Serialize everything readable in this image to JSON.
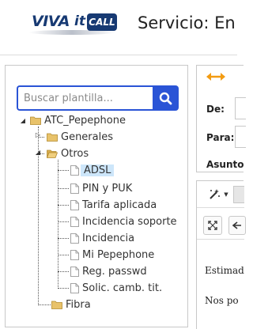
{
  "header": {
    "logo": {
      "brand": "VIVA",
      "brand_suffix": "it",
      "badge": "CALL"
    },
    "title": "Servicio: En"
  },
  "search": {
    "placeholder": "Buscar plantilla..."
  },
  "tree": {
    "root": "ATC_Pepephone",
    "folders": {
      "generales": "Generales",
      "otros": "Otros",
      "fibra": "Fibra"
    },
    "otros_items": [
      "ADSL",
      "PIN y PUK",
      "Tarifa aplicada",
      "Incidencia soporte",
      "Incidencia",
      "Mi Pepephone",
      "Reg. passwd",
      "Solic. camb. tit."
    ],
    "selected": "ADSL"
  },
  "message_form": {
    "de_label": "De:",
    "para_label": "Para:",
    "asunto_label": "Asunto"
  },
  "editor": {
    "body_line_1": "Estimad",
    "body_line_2": "Nos po"
  },
  "colors": {
    "accent_blue": "#2a54d6",
    "swap_arrows": "#f39c12",
    "selected_bg": "#cde6fa",
    "folder": "#e8c26a"
  }
}
